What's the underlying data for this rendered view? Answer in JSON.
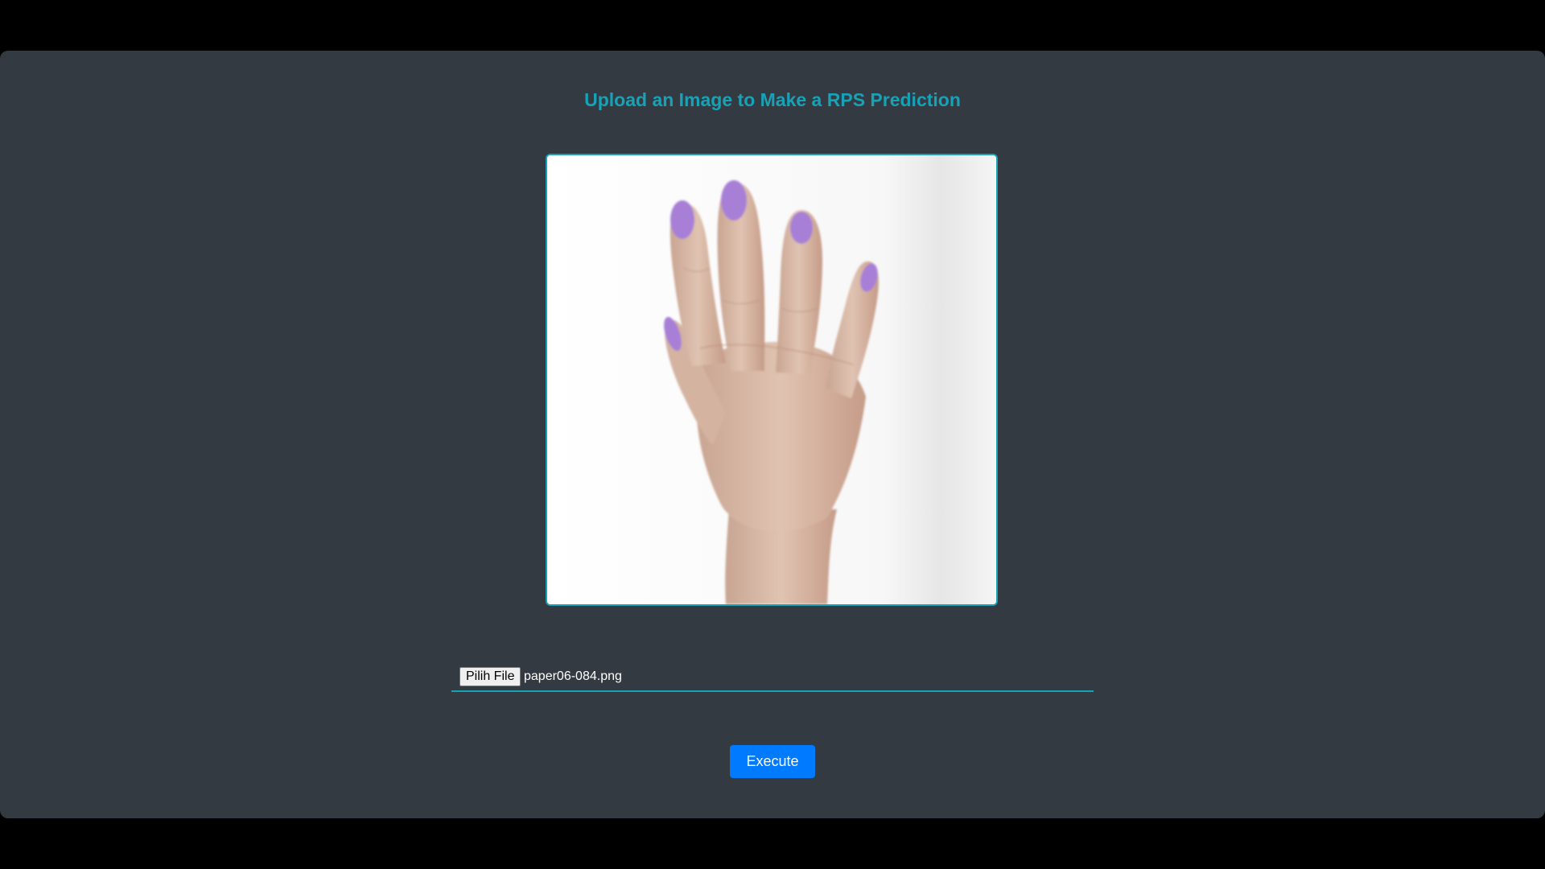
{
  "page": {
    "title": "Upload an Image to Make a RPS Prediction"
  },
  "preview": {
    "icon": "hand-paper-image",
    "nail_color": "#a77fd6",
    "skin_color": "#d9b9a6",
    "border_color": "#17a2b8"
  },
  "upload": {
    "choose_label": "Pilih File",
    "file_name": "paper06-084.png"
  },
  "actions": {
    "execute_label": "Execute"
  },
  "colors": {
    "accent": "#17a2b8",
    "primary_button": "#007bff",
    "panel": "#343a41",
    "backdrop": "#000000"
  }
}
